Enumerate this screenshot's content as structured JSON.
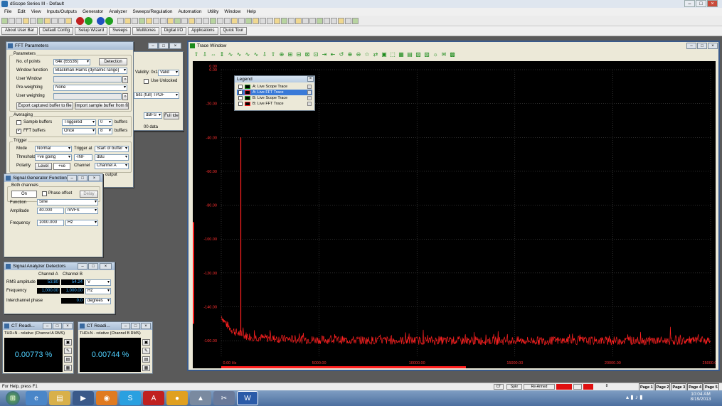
{
  "window": {
    "title": "dScope Series III - Default"
  },
  "menu": [
    "File",
    "Edit",
    "View",
    "Inputs/Outputs",
    "Generator",
    "Analyzer",
    "Sweeps/Regulation",
    "Automation",
    "Utility",
    "Window",
    "Help"
  ],
  "quick_buttons": [
    "About User Bar",
    "Default Config",
    "Setup Wizard",
    "Sweeps",
    "Multitones",
    "Digital I/O",
    "Applications",
    "Quick Tour"
  ],
  "fft": {
    "title": "FFT Parameters",
    "params_group": "Parameters",
    "points_label": "No. of points",
    "points_value": "64k (65536)",
    "detection_btn": "Detection",
    "user_btn": "User Def...",
    "window_label": "Window function",
    "window_value": "Blackman-Harris (dynamic range)",
    "user_window_label": "User Window",
    "preweighting_label": "Pre-weighting",
    "preweighting_value": "None",
    "user_weighting_label": "User weighting",
    "export_btn": "Export captured buffer to file",
    "import_btn": "Import sample buffer from file",
    "averaging_group": "Averaging",
    "sample_buffers": "Sample buffers",
    "sample_mode": "Triggered",
    "sample_count": "0",
    "buffers_label": "buffers",
    "fft_buffers": "FFT buffers",
    "fft_mode": "Once",
    "fft_count": "8",
    "trigger_group": "Trigger",
    "mode_label": "Mode",
    "mode_value": "Normal",
    "trigger_at_label": "Trigger at",
    "trigger_at_value": "Start of buffer",
    "threshold_label": "Threshold",
    "threshold_value": "+ve going",
    "threshold_inf": "-INF",
    "threshold_unit": "dBu",
    "polarity_label": "Polarity",
    "level_btn": "Level",
    "ve_btn": "+ve",
    "channel_label": "Channel",
    "channel_value": "Channel A",
    "right_validity": "Validity: 0x18",
    "right_valid": "Valid",
    "right_use_unlocked": "Use Unlocked",
    "right_tpdf": "bits (full) TPDF",
    "right_dbfs": "dBFS",
    "right_more": "Full tde",
    "right_data": "00 data",
    "right_output": "output"
  },
  "siggen": {
    "title": "Signal Generator Function",
    "group": "Both channels",
    "on_btn": "On",
    "phase_label": "Phase offset",
    "delay_btn": "Delay",
    "function_label": "Function",
    "function_value": "Sine",
    "amplitude_label": "Amplitude",
    "amplitude_value": "40.000",
    "amplitude_unit": "mVFS",
    "frequency_label": "Frequency",
    "frequency_value": "1000.000",
    "frequency_unit": "Hz"
  },
  "detect": {
    "title": "Signal Analyzer Detectors",
    "ch_a": "Channel A",
    "ch_b": "Channel B",
    "rms_label": "RMS amplitude",
    "rms_a": "53.80",
    "rms_b": "54.24",
    "rms_unit": "V",
    "freq_label": "Frequency",
    "freq_a": "1,000.00",
    "freq_b": "1,000.00",
    "freq_unit": "Hz",
    "phase_label": "Interchannel phase",
    "phase_value": "0.0",
    "phase_unit": "degrees"
  },
  "ct1": {
    "title": "CT Readi...",
    "label": "THD+N - relative (Channel A RMS)",
    "value": "0.00773 %"
  },
  "ct2": {
    "title": "CT Readi...",
    "label": "THD+N - relative (Channel B RMS)",
    "value": "0.00744 %"
  },
  "trace": {
    "title": "Trace Window"
  },
  "legend": {
    "title": "Legend",
    "items": [
      {
        "label": "A: Live Scope Trace",
        "checked": false,
        "color": "#1a8a1a"
      },
      {
        "label": "A: Live FFT Trace",
        "checked": true,
        "color": "#ff2020"
      },
      {
        "label": "B: Live Scope Trace",
        "checked": false,
        "color": "#1a8a1a"
      },
      {
        "label": "B: Live FFT Trace",
        "checked": false,
        "color": "#ff2020"
      }
    ]
  },
  "chart_data": {
    "type": "line",
    "yticks": [
      "0.00",
      "-20.00",
      "-40.00",
      "-60.00",
      "-80.00",
      "-100.00",
      "-120.00",
      "-140.00",
      "-160.00"
    ],
    "xticks": [
      "0.00 Hz",
      "5000.00",
      "10000.00",
      "15000.00",
      "20000.00",
      "25000.00"
    ],
    "top_label": "0.00",
    "ylim": [
      -170,
      0
    ],
    "xlim": [
      0,
      25000
    ],
    "series": [
      {
        "color": "#ff2020",
        "peak_x": 1000,
        "peak_y": -40,
        "floor_y": -160
      }
    ]
  },
  "status": {
    "help": "For Help, press F1",
    "ind1": "CT",
    "ind2": "Spkr",
    "ind3": "Re-Armed",
    "ind4": "8",
    "pages": [
      "Page 1",
      "Page 2",
      "Page 3",
      "Page 4",
      "Page 5"
    ]
  },
  "clock": {
    "time": "10:04 AM",
    "date": "8/19/2013"
  }
}
